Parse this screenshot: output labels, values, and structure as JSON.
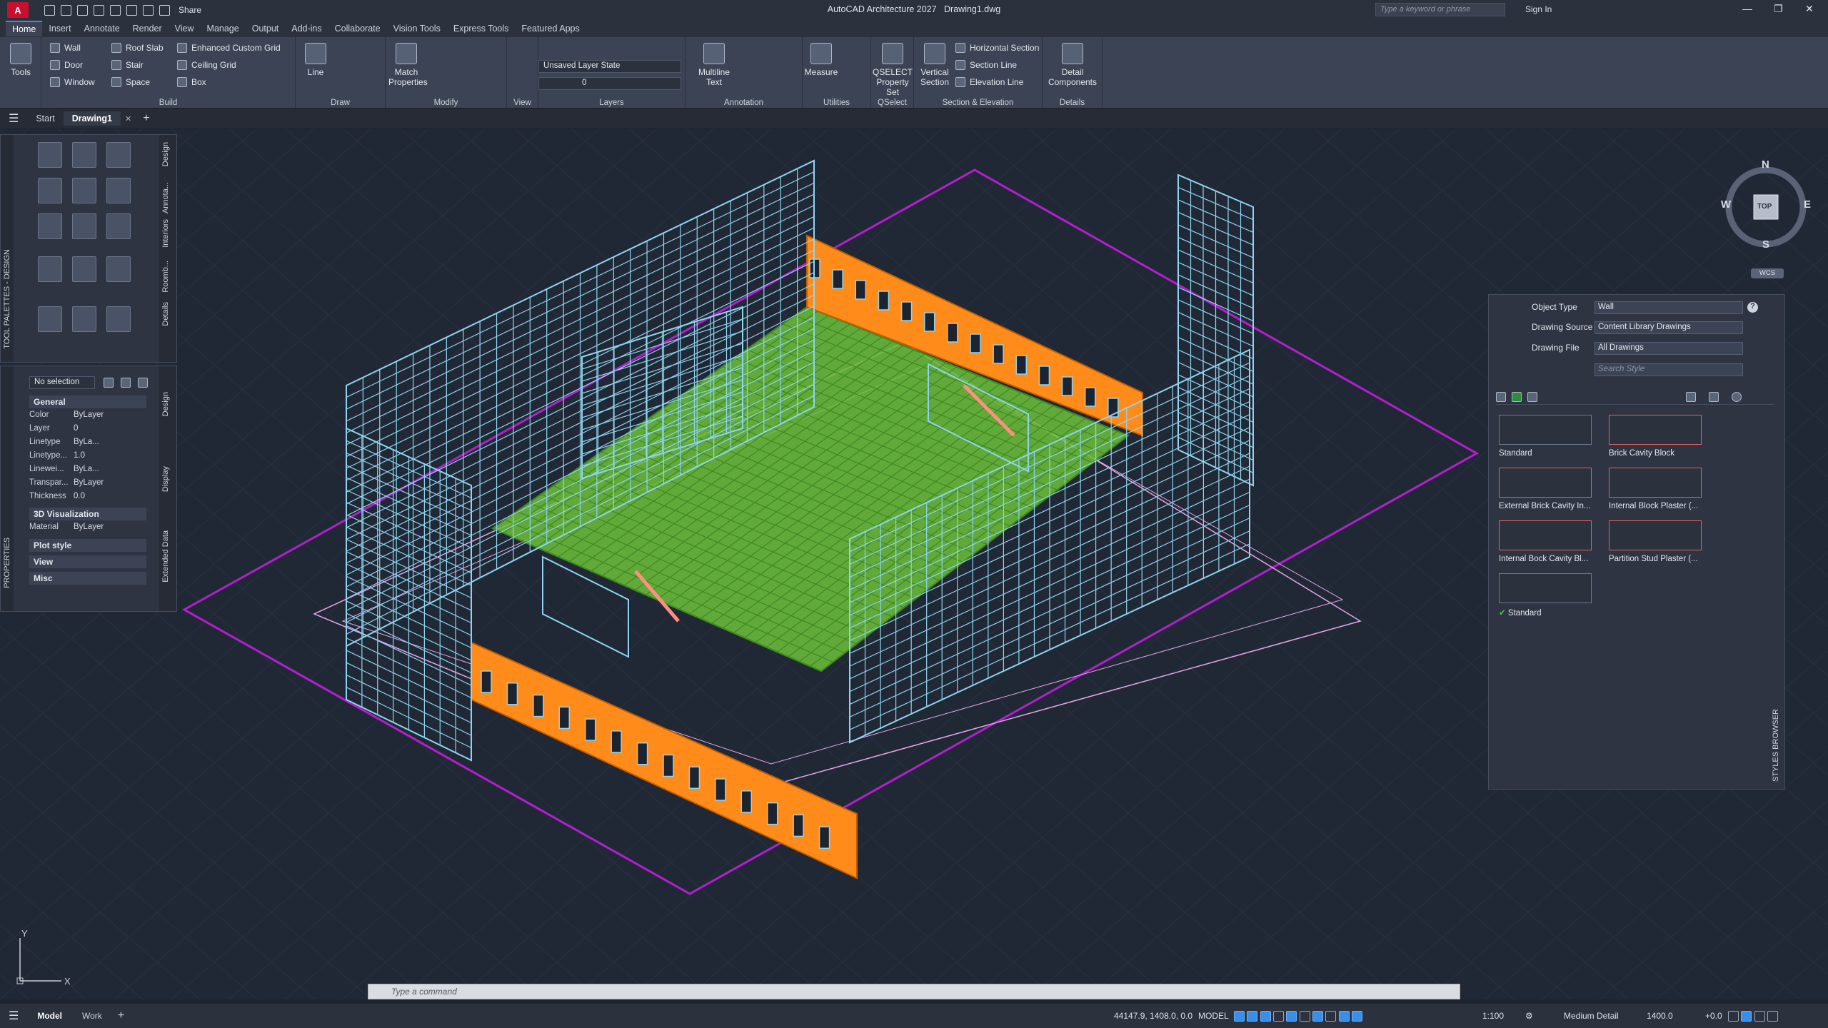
{
  "app": {
    "title": "AutoCAD Architecture 2027",
    "file": "Drawing1.dwg",
    "share": "Share",
    "search_placeholder": "Type a keyword or phrase",
    "sign_in": "Sign In"
  },
  "menu": [
    "Home",
    "Insert",
    "Annotate",
    "Render",
    "View",
    "Manage",
    "Output",
    "Add-ins",
    "Collaborate",
    "Vision Tools",
    "Express Tools",
    "Featured Apps"
  ],
  "ribbon": {
    "tools": "Tools",
    "build": {
      "label": "Build",
      "col1": [
        "Wall",
        "Door",
        "Window"
      ],
      "col2": [
        "Roof Slab",
        "Stair",
        "Space"
      ],
      "col3": [
        "Enhanced Custom Grid",
        "Ceiling Grid",
        "Box"
      ]
    },
    "draw": {
      "label": "Draw",
      "line": "Line"
    },
    "modify": {
      "label": "Modify",
      "match": "Match Properties"
    },
    "view": {
      "label": "View"
    },
    "layers": {
      "label": "Layers",
      "state": "Unsaved Layer State",
      "layer": "0"
    },
    "annotation": {
      "label": "Annotation",
      "mtext": "Multiline Text"
    },
    "utilities": {
      "label": "Utilities",
      "measure": "Measure"
    },
    "qselect": {
      "label": "QSelect",
      "btn": "QSELECT Property Set"
    },
    "section": {
      "label": "Section & Elevation",
      "vertical": "Vertical Section",
      "items": [
        "Horizontal Section",
        "Section Line",
        "Elevation Line"
      ]
    },
    "details": {
      "label": "Details",
      "btn": "Detail Components"
    }
  },
  "doc_tabs": [
    "Start",
    "Drawing1"
  ],
  "tool_palette": {
    "side_label": "TOOL PALETTES - DESIGN",
    "tabs": [
      "Design",
      "Annota...",
      "Interiors",
      "Roomb...",
      "Details"
    ]
  },
  "properties": {
    "side_label": "PROPERTIES",
    "selection": "No selection",
    "tabs": [
      "Design",
      "Display",
      "Extended Data"
    ],
    "general": "General",
    "rows": [
      {
        "k": "Color",
        "v": "ByLayer"
      },
      {
        "k": "Layer",
        "v": "0"
      },
      {
        "k": "Linetype",
        "v": "ByLa..."
      },
      {
        "k": "Linetype...",
        "v": "1.0"
      },
      {
        "k": "Linewei...",
        "v": "ByLa..."
      },
      {
        "k": "Transpar...",
        "v": "ByLayer"
      },
      {
        "k": "Thickness",
        "v": "0.0"
      }
    ],
    "viz": "3D Visualization",
    "material_k": "Material",
    "material_v": "ByLayer",
    "collapsed": [
      "Plot style",
      "View",
      "Misc"
    ]
  },
  "viewcube": {
    "n": "N",
    "s": "S",
    "e": "E",
    "w": "W",
    "face": "TOP",
    "wcs": "WCS"
  },
  "styles_browser": {
    "title": "STYLES BROWSER",
    "object_type_label": "Object Type",
    "object_type": "Wall",
    "drawing_source_label": "Drawing Source",
    "drawing_source": "Content Library Drawings",
    "drawing_file_label": "Drawing File",
    "drawing_file": "All Drawings",
    "search_placeholder": "Search Style",
    "styles": [
      "Standard",
      "Brick Cavity Block",
      "External Brick Cavity In...",
      "Internal Block Plaster (...",
      "Internal Bock Cavity Bl...",
      "Partition Stud Plaster (..."
    ],
    "current": "Standard"
  },
  "command": {
    "placeholder": "Type a command"
  },
  "status": {
    "layouts": [
      "Model",
      "Work"
    ],
    "coords": "44147.9, 1408.0, 0.0",
    "mode": "MODEL",
    "scale": "1:100",
    "detail": "Medium Detail",
    "elevation": "1400.0",
    "offset": "+0.0"
  },
  "colors": {
    "walls": "#8fd4ef",
    "brick": "#ff8c1a",
    "floor": "#6cbf3a",
    "site": "#b31ecf",
    "annot": "#e7a6e8"
  }
}
